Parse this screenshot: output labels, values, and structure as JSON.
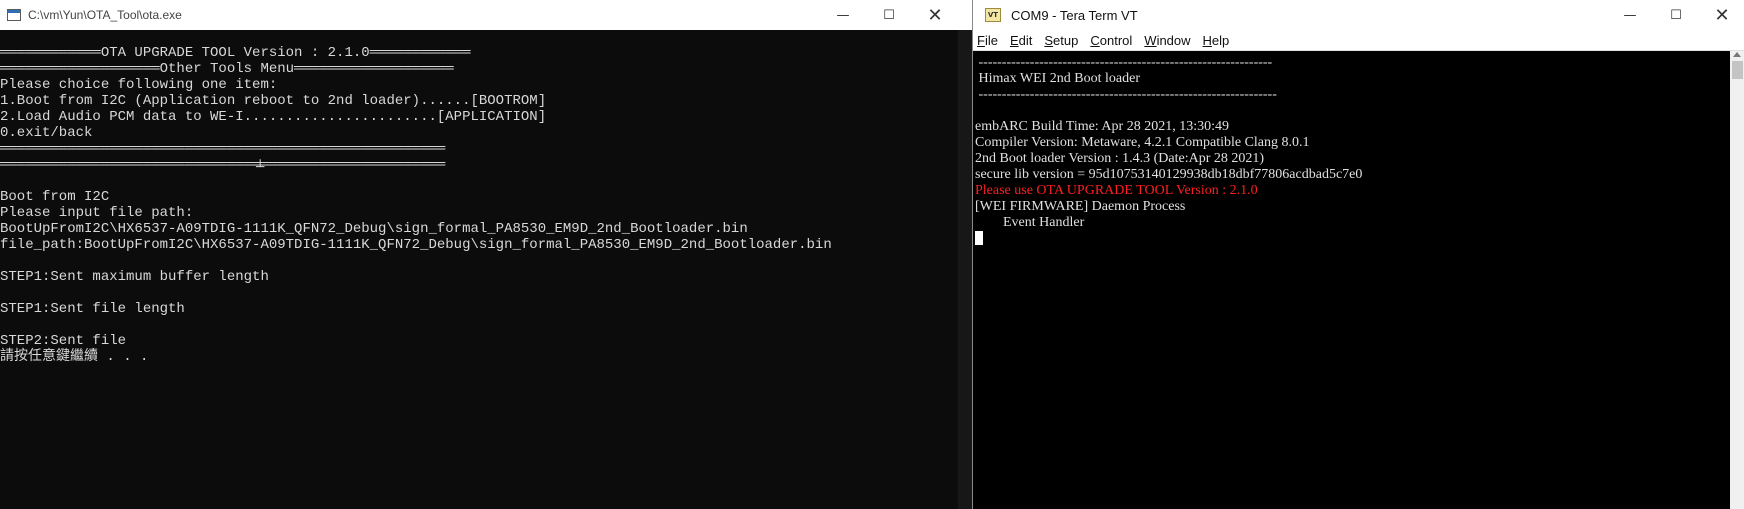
{
  "left_window": {
    "title": "C:\\vm\\Yun\\OTA_Tool\\ota.exe",
    "controls": {
      "minimize": "—",
      "maximize": "☐",
      "close": "✕"
    },
    "console_lines": [
      "════════════OTA UPGRADE TOOL Version : 2.1.0════════════",
      "═══════════════════Other Tools Menu═══════════════════",
      "Please choice following one item:",
      "1.Boot from I2C (Application reboot to 2nd loader)......[BOOTROM]",
      "2.Load Audio PCM data to WE-I.......................[APPLICATION]",
      "0.exit/back",
      "═════════════════════════════════════════════════════",
      "═════════════════════════════════════════════════════",
      "",
      "Boot from I2C",
      "Please input file path:",
      "BootUpFromI2C\\HX6537-A09TDIG-1111K_QFN72_Debug\\sign_formal_PA8530_EM9D_2nd_Bootloader.bin",
      "file_path:BootUpFromI2C\\HX6537-A09TDIG-1111K_QFN72_Debug\\sign_formal_PA8530_EM9D_2nd_Bootloader.bin",
      "",
      "STEP1:Sent maximum buffer length",
      "",
      "STEP1:Sent file length",
      "",
      "STEP2:Sent file",
      "請按任意鍵繼續 . . ."
    ],
    "cursor_glyph": "┴"
  },
  "right_window": {
    "title": "COM9 - Tera Term VT",
    "icon_label": "VT",
    "controls": {
      "minimize": "—",
      "maximize": "☐",
      "close": "✕"
    },
    "menu": [
      {
        "accel": "F",
        "rest": "ile"
      },
      {
        "accel": "E",
        "rest": "dit"
      },
      {
        "accel": "S",
        "rest": "etup"
      },
      {
        "accel": "C",
        "rest": "ontrol"
      },
      {
        "accel": "W",
        "rest": "indow"
      },
      {
        "accel": "H",
        "rest": "elp"
      }
    ],
    "terminal_lines": [
      {
        "text": " ---------------------------------------------------------------",
        "color": "normal"
      },
      {
        "text": " Himax WEI 2nd Boot loader",
        "color": "normal"
      },
      {
        "text": " ----------------------------------------------------------------",
        "color": "normal"
      },
      {
        "text": "",
        "color": "normal"
      },
      {
        "text": "embARC Build Time: Apr 28 2021, 13:30:49",
        "color": "normal"
      },
      {
        "text": "Compiler Version: Metaware, 4.2.1 Compatible Clang 8.0.1",
        "color": "normal"
      },
      {
        "text": "2nd Boot loader Version : 1.4.3 (Date:Apr 28 2021)",
        "color": "normal"
      },
      {
        "text": "secure lib version = 95d10753140129938db18dbf77806acdbad5c7e0",
        "color": "normal"
      },
      {
        "text": "Please use OTA UPGRADE TOOL Version : 2.1.0",
        "color": "red"
      },
      {
        "text": "[WEI FIRMWARE] Daemon Process",
        "color": "normal"
      },
      {
        "text": "        Event Handler",
        "color": "normal"
      }
    ],
    "colors": {
      "highlight": "#ff1f1f",
      "text": "#e0e0e0",
      "background": "#000000"
    }
  }
}
